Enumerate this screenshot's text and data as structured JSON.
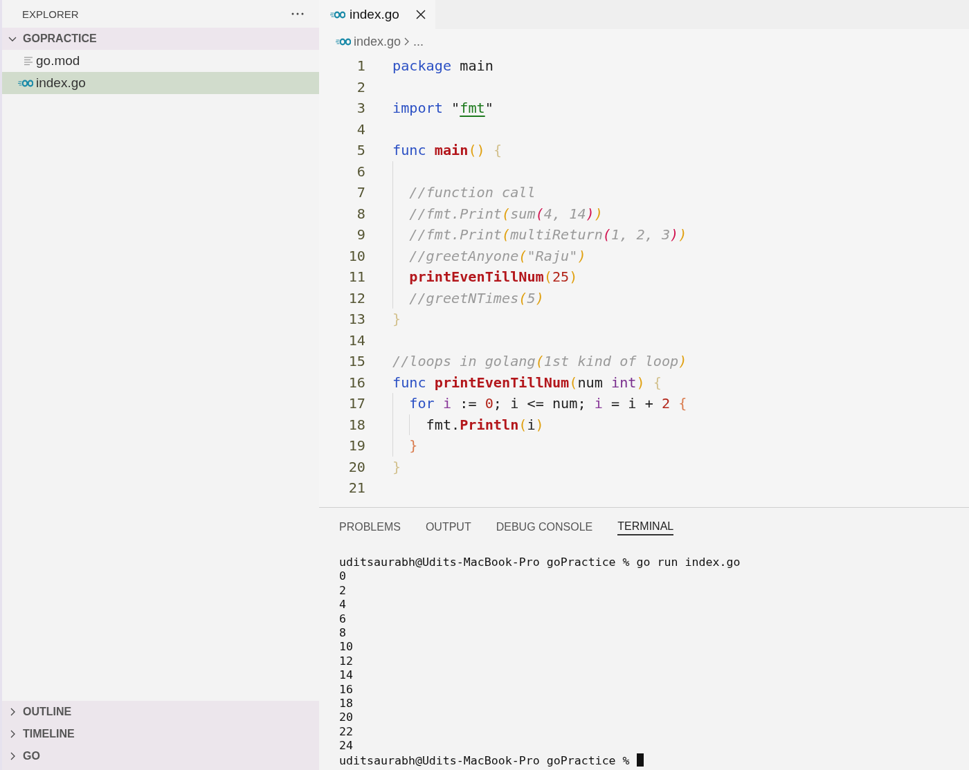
{
  "sidebar": {
    "title": "EXPLORER",
    "folder": {
      "name": "GOPRACTICE",
      "expanded": true,
      "children": [
        {
          "name": "go.mod",
          "kind": "text",
          "selected": false
        },
        {
          "name": "index.go",
          "kind": "go",
          "selected": true
        }
      ]
    },
    "sections": [
      {
        "name": "OUTLINE",
        "expanded": false
      },
      {
        "name": "TIMELINE",
        "expanded": false
      },
      {
        "name": "GO",
        "expanded": false
      }
    ]
  },
  "editor": {
    "tabs": [
      {
        "label": "index.go",
        "kind": "go",
        "selected": true
      }
    ],
    "breadcrumb": {
      "file": "index.go",
      "rest": "..."
    },
    "lines": [
      {
        "number": "1",
        "tokens": [
          {
            "t": "package ",
            "kind": "kw"
          },
          {
            "t": "main",
            "kind": "plain"
          }
        ]
      },
      {
        "number": "2"
      },
      {
        "number": "3",
        "tokens": [
          {
            "t": "import ",
            "kind": "kw"
          },
          {
            "t": "\"",
            "kind": "plain"
          },
          {
            "t": "fmt",
            "kind": "str"
          },
          {
            "t": "\"",
            "kind": "plain"
          }
        ]
      },
      {
        "number": "4"
      },
      {
        "number": "5",
        "tokens": [
          {
            "t": "func ",
            "kind": "kw"
          },
          {
            "t": "main",
            "kind": "fn"
          },
          {
            "t": "(",
            "kind": "br1"
          },
          {
            "t": ") ",
            "kind": "br1"
          },
          {
            "t": "{",
            "kind": "curly1"
          }
        ],
        "children": [
          {
            "number": "6"
          },
          {
            "number": "7",
            "tokens": [
              {
                "t": "//function call",
                "kind": "cmt"
              }
            ]
          },
          {
            "number": "8",
            "tokens": [
              {
                "t": "//fmt.Print",
                "kind": "cmt"
              },
              {
                "t": "(",
                "kind": "cbr1"
              },
              {
                "t": "sum",
                "kind": "cmt"
              },
              {
                "t": "(",
                "kind": "cbr2"
              },
              {
                "t": "4, 14",
                "kind": "cmt"
              },
              {
                "t": ")",
                "kind": "cbr2"
              },
              {
                "t": ")",
                "kind": "cbr1"
              }
            ]
          },
          {
            "number": "9",
            "tokens": [
              {
                "t": "//fmt.Print",
                "kind": "cmt"
              },
              {
                "t": "(",
                "kind": "cbr1"
              },
              {
                "t": "multiReturn",
                "kind": "cmt"
              },
              {
                "t": "(",
                "kind": "cbr2"
              },
              {
                "t": "1, 2, 3",
                "kind": "cmt"
              },
              {
                "t": ")",
                "kind": "cbr2"
              },
              {
                "t": ")",
                "kind": "cbr1"
              }
            ]
          },
          {
            "number": "10",
            "tokens": [
              {
                "t": "//greetAnyone",
                "kind": "cmt"
              },
              {
                "t": "(",
                "kind": "cbr1"
              },
              {
                "t": "\"Raju\"",
                "kind": "cmt"
              },
              {
                "t": ")",
                "kind": "cbr1"
              }
            ]
          },
          {
            "number": "11",
            "tokens": [
              {
                "t": "printEvenTillNum",
                "kind": "fn"
              },
              {
                "t": "(",
                "kind": "br1"
              },
              {
                "t": "25",
                "kind": "num"
              },
              {
                "t": ")",
                "kind": "br1"
              }
            ]
          },
          {
            "number": "12",
            "tokens": [
              {
                "t": "//greetNTimes",
                "kind": "cmt"
              },
              {
                "t": "(",
                "kind": "cbr1"
              },
              {
                "t": "5",
                "kind": "cmt"
              },
              {
                "t": ")",
                "kind": "cbr1"
              }
            ]
          }
        ]
      },
      {
        "number": "13",
        "tokens": [
          {
            "t": "}",
            "kind": "curly1"
          }
        ]
      },
      {
        "number": "14"
      },
      {
        "number": "15",
        "tokens": [
          {
            "t": "//loops in golang",
            "kind": "cmt"
          },
          {
            "t": "(",
            "kind": "cbr1"
          },
          {
            "t": "1st kind of loop",
            "kind": "cmt"
          },
          {
            "t": ")",
            "kind": "cbr1"
          }
        ]
      },
      {
        "number": "16",
        "tokens": [
          {
            "t": "func ",
            "kind": "kw"
          },
          {
            "t": "printEvenTillNum",
            "kind": "fn"
          },
          {
            "t": "(",
            "kind": "br1"
          },
          {
            "t": "num ",
            "kind": "plain"
          },
          {
            "t": "int",
            "kind": "type"
          },
          {
            "t": ") ",
            "kind": "br1"
          },
          {
            "t": "{",
            "kind": "curly1"
          }
        ],
        "children": [
          {
            "number": "17",
            "tokens": [
              {
                "t": "for ",
                "kind": "kw"
              },
              {
                "t": "i",
                "kind": "var"
              },
              {
                "t": " := ",
                "kind": "plain"
              },
              {
                "t": "0",
                "kind": "num"
              },
              {
                "t": "; i <= num; ",
                "kind": "plain"
              },
              {
                "t": "i",
                "kind": "var"
              },
              {
                "t": " = i + ",
                "kind": "plain"
              },
              {
                "t": "2 ",
                "kind": "num"
              },
              {
                "t": "{",
                "kind": "curly2"
              }
            ],
            "children": [
              {
                "number": "18",
                "tokens": [
                  {
                    "t": "fmt.",
                    "kind": "plain"
                  },
                  {
                    "t": "Println",
                    "kind": "fn"
                  },
                  {
                    "t": "(",
                    "kind": "br1"
                  },
                  {
                    "t": "i",
                    "kind": "plain"
                  },
                  {
                    "t": ")",
                    "kind": "br1"
                  }
                ]
              }
            ]
          },
          {
            "number": "19",
            "tokens": [
              {
                "t": "}",
                "kind": "curly2"
              }
            ]
          }
        ]
      },
      {
        "number": "20",
        "tokens": [
          {
            "t": "}",
            "kind": "curly1"
          }
        ]
      },
      {
        "number": "21"
      }
    ]
  },
  "panel": {
    "tabs": [
      {
        "label": "PROBLEMS",
        "selected": false
      },
      {
        "label": "OUTPUT",
        "selected": false
      },
      {
        "label": "DEBUG CONSOLE",
        "selected": false
      },
      {
        "label": "TERMINAL",
        "selected": true
      }
    ],
    "terminal": {
      "cursor": true,
      "lines": [
        "uditsaurabh@Udits-MacBook-Pro goPractice % go run index.go",
        "0",
        "2",
        "4",
        "6",
        "8",
        "10",
        "12",
        "14",
        "16",
        "18",
        "20",
        "22",
        "24",
        "uditsaurabh@Udits-MacBook-Pro goPractice %"
      ]
    }
  }
}
